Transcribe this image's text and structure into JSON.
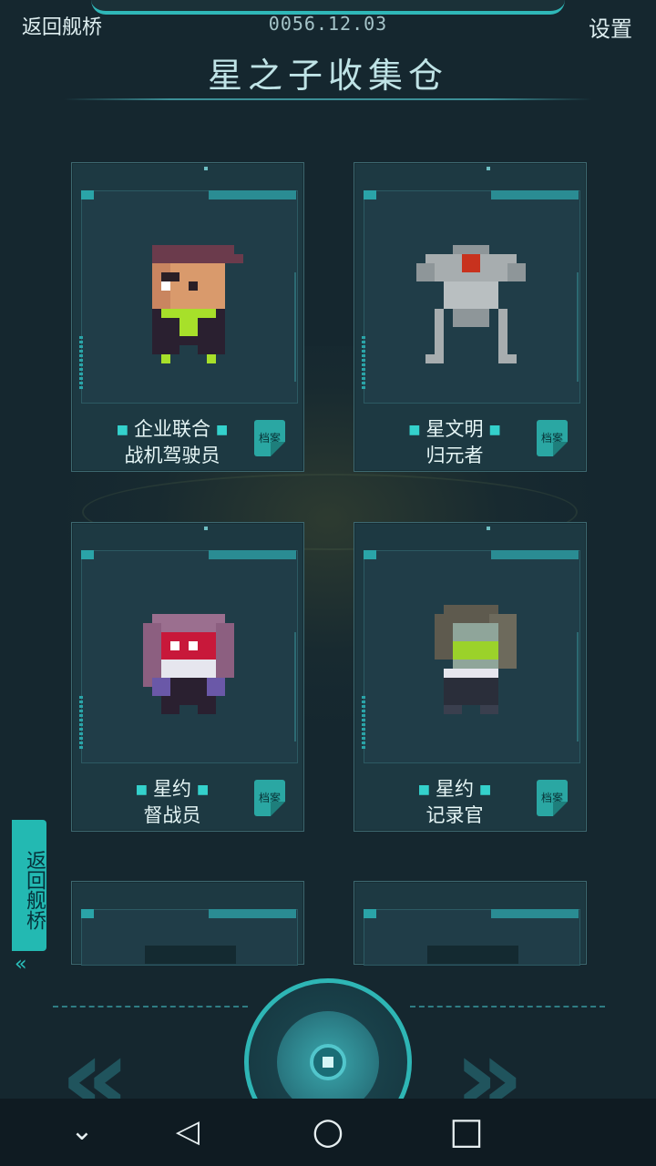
{
  "header": {
    "back_label": "返回舰桥",
    "date": "0056.12.03",
    "settings_label": "设置",
    "title": "星之子收集仓"
  },
  "cards": [
    {
      "line1": "企业联合",
      "line2": "战机驾驶员",
      "archive_label": "档案"
    },
    {
      "line1": "星文明",
      "line2": "归元者",
      "archive_label": "档案"
    },
    {
      "line1": "星约",
      "line2": "督战员",
      "archive_label": "档案"
    },
    {
      "line1": "星约",
      "line2": "记录官",
      "archive_label": "档案"
    }
  ],
  "side_tab": {
    "label": "返回舰桥",
    "arrows_glyph": "‹‹"
  },
  "bottom_controls": {
    "prev_glyph": "«",
    "next_glyph": "»"
  },
  "navbar": {
    "down_glyph": "⌄",
    "back_glyph": "◁",
    "home_glyph": "○",
    "recents_glyph": "□"
  },
  "colors": {
    "accent": "#2eb6b5",
    "background": "#15272f",
    "card": "#1d3942"
  }
}
